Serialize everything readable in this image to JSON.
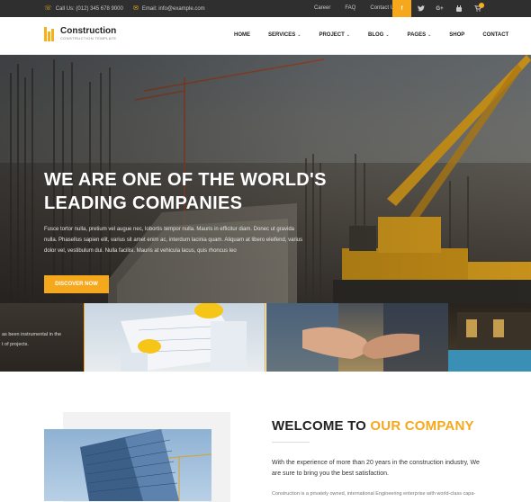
{
  "topbar": {
    "call": "Call Us: (012) 345 678 9000",
    "email": "Email: info@example.com",
    "links": [
      "Career",
      "FAQ",
      "Contact Us"
    ],
    "socials": [
      "f",
      "t",
      "G+",
      "yt",
      "cart"
    ]
  },
  "brand": {
    "name": "Construction",
    "tagline": "CONSTRUCTION TEMPLATE",
    "accent_color": "#f6a81c",
    "topbar_color": "#2f2f2f"
  },
  "nav": {
    "items": [
      {
        "label": "HOME",
        "dropdown": false
      },
      {
        "label": "SERVICES",
        "dropdown": true
      },
      {
        "label": "PROJECT",
        "dropdown": true
      },
      {
        "label": "BLOG",
        "dropdown": true
      },
      {
        "label": "PAGES",
        "dropdown": true
      },
      {
        "label": "SHOP",
        "dropdown": false
      },
      {
        "label": "CONTACT",
        "dropdown": false
      }
    ]
  },
  "hero": {
    "title": "WE ARE ONE OF THE WORLD'S LEADING COMPANIES",
    "text": "Fusce tortor nulla, pretium vel augue nec, lobortis tempor nulla. Mauris in efficitur diam. Donec ut gravida nulla. Phasellus sapien elit, varius sit amet enim ac, interdum lacinia quam. Aliquam at libero eleifend, varius dolor vel, vestibulum dui. Nulla facilisi. Mauris at vehicula lacus, quis rhoncus leo",
    "button": "DISCOVER NOW"
  },
  "strip": {
    "caption_line1": "as been instrumental in the",
    "caption_line2": "t of projects."
  },
  "welcome": {
    "title_plain": "WELCOME TO ",
    "title_accent": "OUR COMPANY",
    "para1": "With the experience of more than 20 years in the construction industry, We are sure to bring you the best satisfaction.",
    "para2": "Construction is a privately owned, international Engineering enterprise with world-class capa-"
  }
}
